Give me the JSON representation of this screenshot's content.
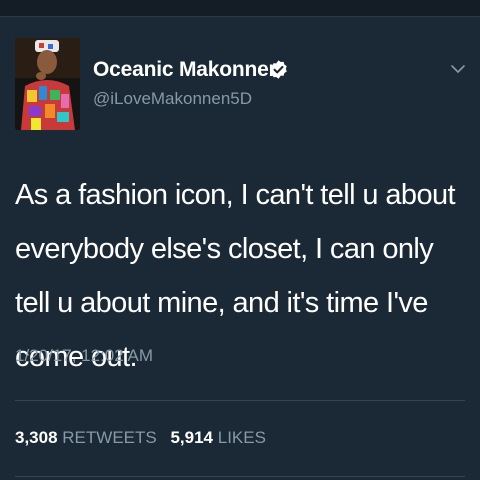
{
  "tweet": {
    "display_name": "Oceanic Makonnen",
    "handle": "@iLoveMakonnen5D",
    "text": "As a fashion icon, I can't tell u about everybody else's closet, I can only tell u about mine, and it's time I've come out.",
    "timestamp": "1/20/17, 12:02 AM",
    "retweets_count": "3,308",
    "retweets_label": "RETWEETS",
    "likes_count": "5,914",
    "likes_label": "LIKES"
  },
  "icons": {
    "verified": "verified-badge-icon",
    "menu": "chevron-down-icon"
  },
  "colors": {
    "background": "#1b2836",
    "secondary_text": "#8899a6",
    "divider": "#38444d"
  }
}
